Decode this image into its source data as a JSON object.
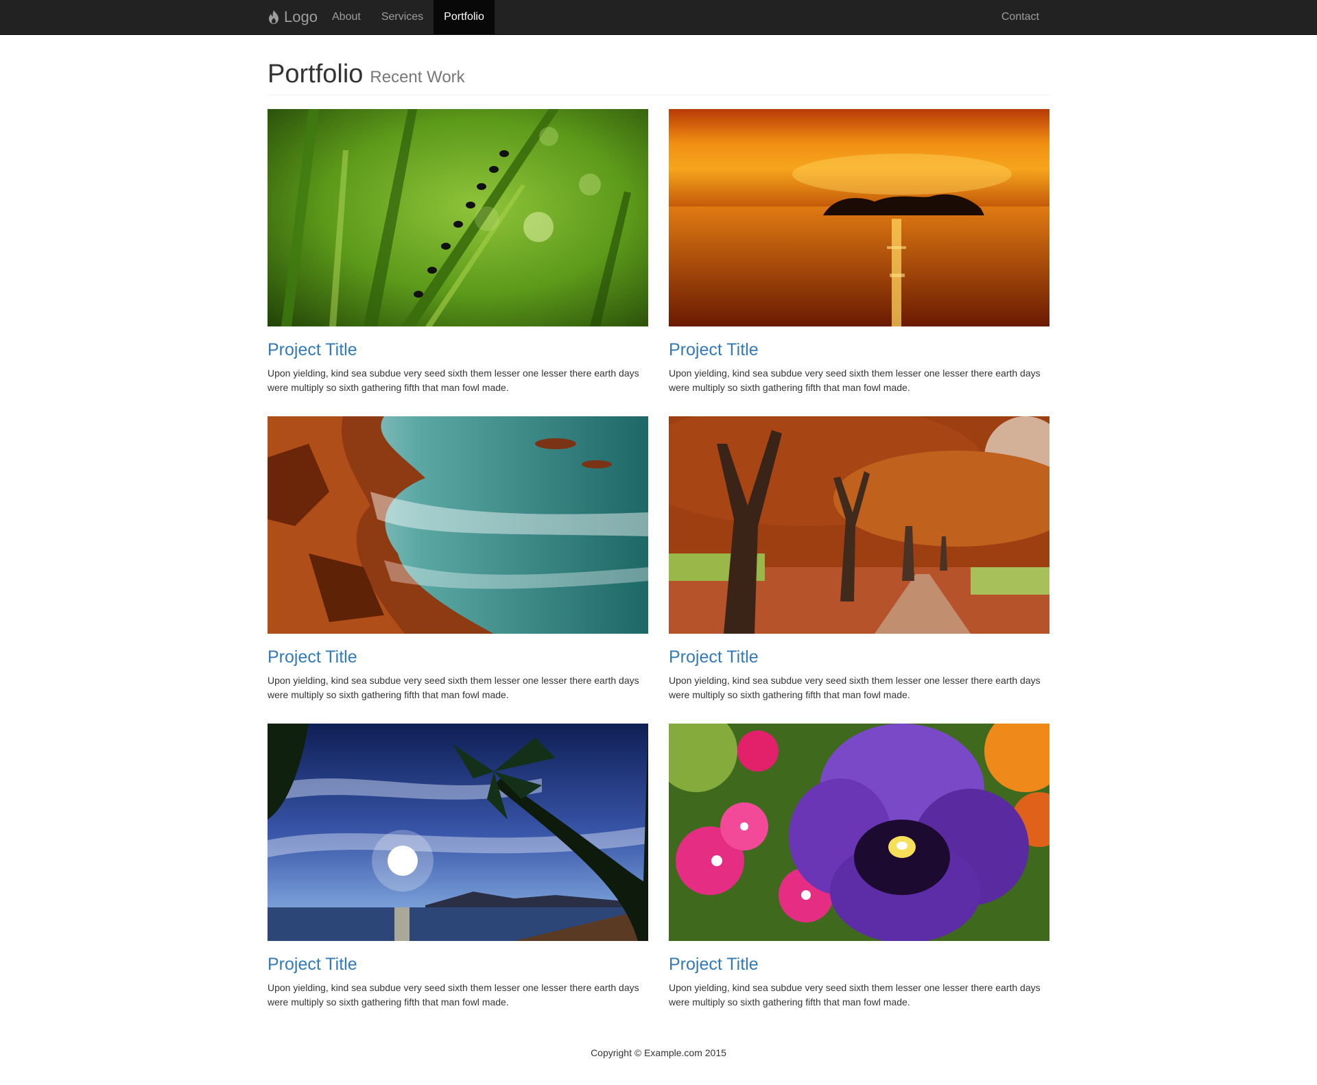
{
  "navbar": {
    "brand": "Logo",
    "brand_icon": "flame-icon",
    "links": [
      {
        "label": "About"
      },
      {
        "label": "Services"
      },
      {
        "label": "Portfolio",
        "active": true
      }
    ],
    "right_links": [
      {
        "label": "Contact"
      }
    ]
  },
  "header": {
    "title": "Portfolio",
    "subtitle": "Recent Work"
  },
  "projects": [
    {
      "title": "Project Title",
      "description": "Upon yielding, kind sea subdue very seed sixth them lesser one lesser there earth days were multiply so sixth gathering fifth that man fowl made.",
      "image": "ants-on-grass-photo"
    },
    {
      "title": "Project Title",
      "description": "Upon yielding, kind sea subdue very seed sixth them lesser one lesser there earth days were multiply so sixth gathering fifth that man fowl made.",
      "image": "sunset-island-photo"
    },
    {
      "title": "Project Title",
      "description": "Upon yielding, kind sea subdue very seed sixth them lesser one lesser there earth days were multiply so sixth gathering fifth that man fowl made.",
      "image": "rocky-coast-photo"
    },
    {
      "title": "Project Title",
      "description": "Upon yielding, kind sea subdue very seed sixth them lesser one lesser there earth days were multiply so sixth gathering fifth that man fowl made.",
      "image": "autumn-trees-photo"
    },
    {
      "title": "Project Title",
      "description": "Upon yielding, kind sea subdue very seed sixth them lesser one lesser there earth days were multiply so sixth gathering fifth that man fowl made.",
      "image": "tropical-beach-photo"
    },
    {
      "title": "Project Title",
      "description": "Upon yielding, kind sea subdue very seed sixth them lesser one lesser there earth days were multiply so sixth gathering fifth that man fowl made.",
      "image": "pansy-flower-photo"
    }
  ],
  "footer": {
    "copyright": "Copyright © Example.com 2015"
  },
  "colors": {
    "navbar_bg": "#222222",
    "link": "#337ab7",
    "active_bg": "#080808"
  }
}
